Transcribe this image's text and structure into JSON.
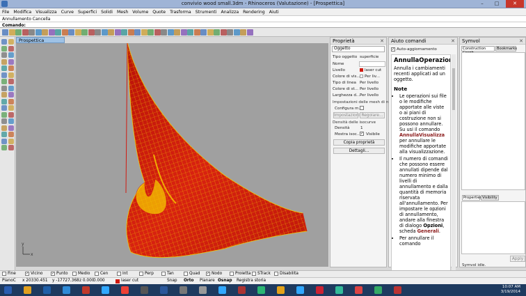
{
  "window": {
    "title": "convivio wood small.3dm - Rhinoceros (Valutazione) - [Prospettica]",
    "min": "–",
    "max": "□",
    "close": "✕"
  },
  "menu": [
    "File",
    "Modifica",
    "Visualizza",
    "Curve",
    "Superfici",
    "Solidi",
    "Mesh",
    "Volume",
    "Quote",
    "Trasforma",
    "Strumenti",
    "Analizza",
    "Rendering",
    "Aiuti"
  ],
  "command": {
    "history": "Annullamento Cancella",
    "prompt": "Comando:",
    "value": ""
  },
  "viewport": {
    "tab": "Prospettica",
    "axis_x": "x",
    "axis_y": "y"
  },
  "properties": {
    "title": "Proprietà",
    "selector": "Oggetto",
    "rows": [
      {
        "label": "Tipo oggetto",
        "value": "superficie"
      },
      {
        "label": "Nome",
        "value": ""
      },
      {
        "label": "Livello",
        "value": "laser cut"
      },
      {
        "label": "Colore di vis...",
        "value": "Per liv..."
      },
      {
        "label": "Tipo di linea",
        "value": "Per livello"
      },
      {
        "label": "Colore di st...",
        "value": "Per livello"
      },
      {
        "label": "Larghezza d...",
        "value": "Per livello"
      }
    ],
    "mesh_section": "Impostazioni delle mesh di ren...",
    "configure": "Configura m...",
    "btn_settings": "Impostazioni",
    "btn_rules": "Regolare...",
    "iso_section": "Densità delle isocurve",
    "density_label": "Densità",
    "density_value": "1",
    "show_iso_label": "Mostra isoc...",
    "show_iso_value": "Visibile",
    "btn_copy": "Copia proprietà",
    "btn_details": "Dettagli..."
  },
  "help": {
    "title": "Aiuto comandi",
    "auto": "Auto-aggiornamento",
    "h1": "AnnullaOperazione",
    "intro": "Annulla i cambiamenti recenti applicati ad un oggetto.",
    "note": "Note",
    "b1a": "Le operazioni sui file o le modifiche apportate alle viste o ai piani di costruzione non si possono annullare. Su usi il comando",
    "b1cmd": "AnnullaVisualizza",
    "b1b": "per annullare le modifiche apportate alla visualizzazione.",
    "b2a": "Il numero di comandi che possono essere annullati dipende dal numero minimo di livelli di annullamento e dalla quantità di memoria riservata all'annullamento. Per impostare le opzioni di annullamento, andare alla finestra di dialogo",
    "b2opt": "Opzioni",
    "b2b": ", scheda",
    "b2gen": "Generali",
    "b3": "Per annullare il comando"
  },
  "symbol": {
    "title": "Symvol",
    "tab1": "Construction Graph",
    "tab2": "Bookmarks",
    "tab3": "Properties",
    "tab4": "Visibility",
    "apply": "Apply",
    "status": "Symvol idle."
  },
  "osnap": [
    "Fine",
    "Vicino",
    "Punto",
    "Medio",
    "Cen",
    "Int",
    "Perp",
    "Tan",
    "Quad",
    "Nodo",
    "Proietta",
    "STrack",
    "Disabilita"
  ],
  "osnap_checked": [
    false,
    true,
    true,
    false,
    false,
    false,
    false,
    false,
    false,
    true,
    false,
    false,
    false
  ],
  "status": {
    "cplane": "PianoC",
    "x": "x 20330.451",
    "y": "y -17727.368",
    "z": "z 0.000",
    "dist": "0.000",
    "layer": "laser cut",
    "snap": "Snap",
    "ortho": "Orto",
    "planar": "Planare",
    "osnap": "Osnap",
    "record": "Registra storia"
  },
  "clock": {
    "time": "10:07 AM",
    "date": "3/19/2014"
  },
  "colors": {
    "surface_front": "#d01a10",
    "surface_back": "#f5c800",
    "viewport": "#a0a0a0",
    "taskbar": "#1e3a5f"
  }
}
